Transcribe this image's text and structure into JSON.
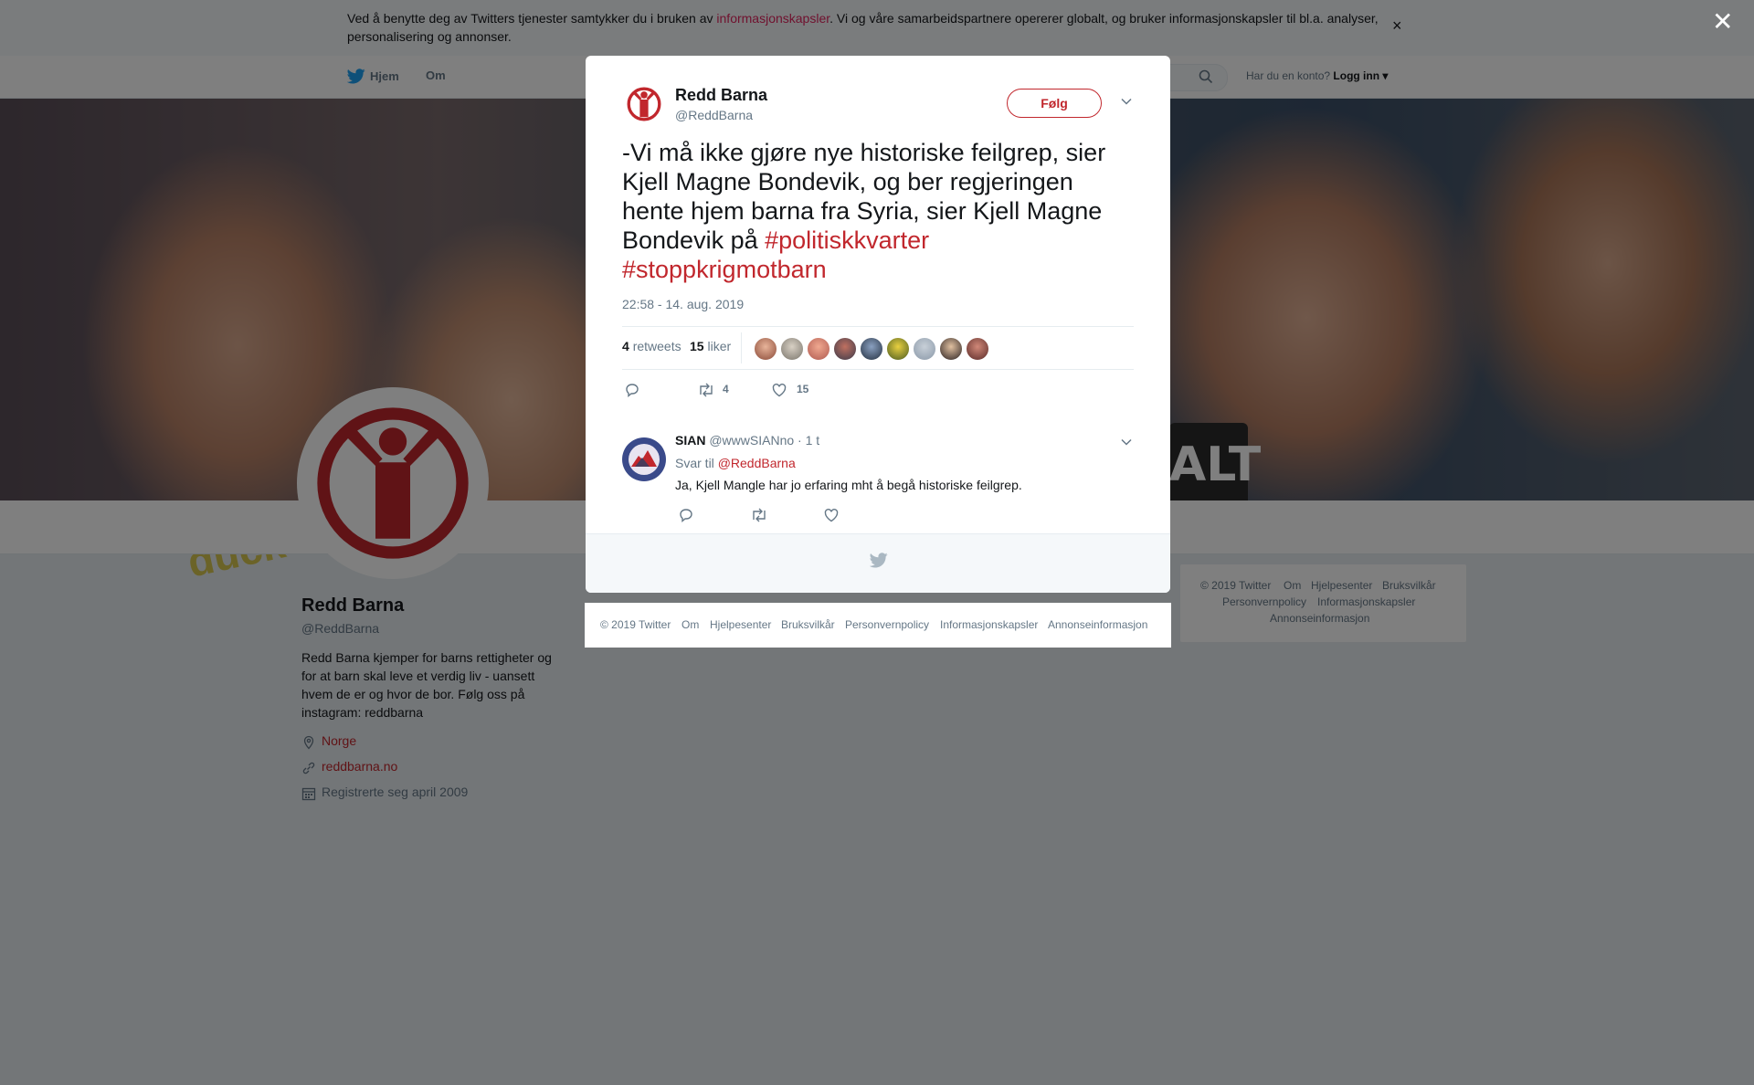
{
  "cookie_banner": {
    "text_before": "Ved å benytte deg av Twitters tjenester samtykker du i bruken av ",
    "link": "informasjonskapsler",
    "text_after": ". Vi og våre samarbeidspartnere opererer globalt, og bruker informasjonskapsler til bl.a. analyser, personalisering og annonser.",
    "close": "×"
  },
  "nav": {
    "home": "Hjem",
    "about": "Om",
    "login_prompt": "Har du en konto?",
    "login": "Logg inn"
  },
  "profile": {
    "name": "Redd Barna",
    "handle": "@ReddBarna",
    "bio": "Redd Barna kjemper for barns rettigheter og for at barn skal leve et verdig liv - uansett hvem de er og hvor de bor. Følg oss på instagram: reddbarna",
    "location": "Norge",
    "url": "reddbarna.no",
    "joined": "Registrerte seg april 2009"
  },
  "banner": {
    "sign_text": "ALT",
    "shirt_text": "duck"
  },
  "sidebar_footer": {
    "links": [
      "© 2019 Twitter",
      "Om",
      "Hjelpesenter",
      "Bruksvilkår",
      "Personvernpolicy",
      "Informasjonskapsler",
      "Annonseinformasjon"
    ]
  },
  "overlay_close": "✕",
  "tweet": {
    "author_name": "Redd Barna",
    "author_handle": "@ReddBarna",
    "follow_label": "Følg",
    "text_main": "-Vi må ikke gjøre nye historiske feilgrep, sier Kjell Magne Bondevik, og ber regjeringen hente hjem barna fra Syria, sier Kjell Magne Bondevik på ",
    "hashtag1": "#politiskkvarter",
    "hashtag2": "#stoppkrigmotbarn",
    "timestamp": "22:58 - 14. aug. 2019",
    "retweets_count": "4",
    "retweets_label": "retweets",
    "likes_count": "15",
    "likes_label": "liker",
    "action_retweet_count": "4",
    "action_like_count": "15"
  },
  "reply": {
    "name": "SIAN",
    "handle": "@wwwSIANno",
    "time": "· 1 t",
    "reply_to_label": "Svar til",
    "reply_to_handle": "@ReddBarna",
    "text": "Ja, Kjell Mangle har jo erfaring mht å begå historiske feilgrep."
  },
  "modal_footer": {
    "links": [
      "© 2019 Twitter",
      "Om",
      "Hjelpesenter",
      "Bruksvilkår",
      "Personvernpolicy",
      "Informasjonskapsler",
      "Annonseinformasjon"
    ]
  },
  "colors": {
    "brand_red": "#c1272d",
    "hashtag_red": "#c1272d",
    "twitter_blue": "#1da1f2",
    "overlay": "rgba(0,0,0,0.5)"
  },
  "icons": {
    "twitter_bird": "twitter-bird-icon",
    "search": "search-icon",
    "location": "location-pin-icon",
    "link": "link-icon",
    "calendar": "calendar-icon",
    "reply": "reply-icon",
    "retweet": "retweet-icon",
    "like": "heart-icon",
    "caret": "chevron-down-icon"
  }
}
